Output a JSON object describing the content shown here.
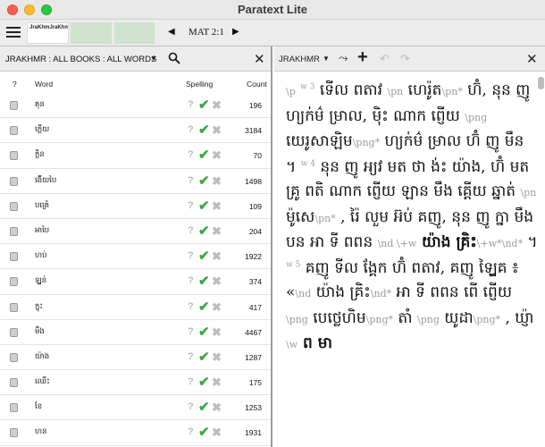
{
  "window": {
    "title": "Paratext Lite"
  },
  "toolbar": {
    "tab1": "JraKhmJraKhm",
    "reference": "MAT 2:1"
  },
  "left": {
    "header": "JRAKHMR : ALL BOOKS : ALL WORDS",
    "columns": {
      "q": "?",
      "word": "Word",
      "spelling": "Spelling",
      "count": "Count"
    },
    "rows": [
      {
        "word": "គុន",
        "count": "196"
      },
      {
        "word": "ក្តើយ",
        "count": "3184"
      },
      {
        "word": "ក្តិន",
        "count": "70"
      },
      {
        "word": "ង់ើយបៃ",
        "count": "1498"
      },
      {
        "word": "បគ្រេំ",
        "count": "109"
      },
      {
        "word": "អាបៃ",
        "count": "204"
      },
      {
        "word": "ហប់",
        "count": "1922"
      },
      {
        "word": "ឡ្វន់",
        "count": "374"
      },
      {
        "word": "ក្នុះ",
        "count": "417"
      },
      {
        "word": "មឹង",
        "count": "4467"
      },
      {
        "word": "យ៉ាង",
        "count": "1287"
      },
      {
        "word": "ឈើះ",
        "count": "175"
      },
      {
        "word": "ខែ",
        "count": "1253"
      },
      {
        "word": "ហន",
        "count": "1931"
      }
    ]
  },
  "right": {
    "header": "JRAKHMR",
    "text": {
      "v3": "w 3",
      "m_p": "\\p",
      "s1": "ទើល ពតាវ ",
      "m_pn": "\\pn",
      "s2": " ហេរ៉ូត",
      "m_pnstar": "\\pn*",
      "s3": " ហ៊ំ, នុន ញូ ហ្យក់ម៌ ម្រាល, ម៉ិះ ណាក ព្ញើយ ",
      "m_png": "\\png",
      "s4": " យេរូសាឡិម",
      "m_pngstar": "\\png*",
      "s5": " ហ្យក់ម៌ ម្រាល ហ៊ំ ញូ មឹន ។ ",
      "v4": "w 4",
      "s6": " នុន ញូ អ្យវ មត ថា ង់ះ យ៉ាង, ហ៊ំ មត គ្រូ ពតិ ណាក ព្ញើយ ឡាន មឹង គ្តើយ ឆ្នាត់ ",
      "m_pn2": "\\pn",
      "s7": " ម៉ូសេ",
      "m_pnstar2": "\\pn*",
      "s8": " , រ៉ៃ លួម អ៊ប់ គញូ, នុន ញូ ក្នា មឹង បន អា ទី ពពន ",
      "m_nd": "\\nd \\+w",
      "s9": " យ៉ាង គ្រិះ",
      "m_wstar": "\\+w*\\nd*",
      "s10": " ។ ",
      "v5": "w 5",
      "s11": " គញូ ទីល ង្គែក ហ៊ំ ពតាវ, គញូ ឡ្វៃគ ៖ «",
      "m_nd2": "\\nd",
      "s12": " យ៉ាង គ្រិះ",
      "m_ndstar": "\\nd*",
      "s13": " អា ទី ពពន ពើ ព្ញើយ ",
      "m_png2": "\\png",
      "s14": " បេថ្លេហិម",
      "m_pngstar2": "\\png*",
      "s15": " តាំ ",
      "m_png3": "\\png",
      "s16": " យូដា",
      "m_pngstar3": "\\png*",
      "s17": " , ឃ្ញ៉ា ",
      "m_w": "\\w",
      "s18": " ព មា"
    }
  },
  "colors": {
    "check": "#39a845",
    "marker": "#9b9b9b",
    "pane_bg": "#ececec"
  }
}
